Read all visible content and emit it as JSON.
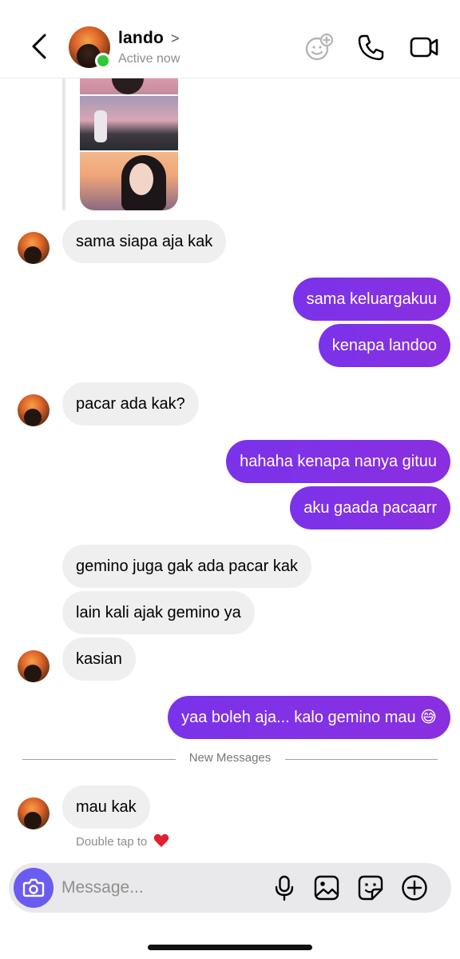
{
  "header": {
    "contact_name": "lando",
    "status": "Active now",
    "chevron": ">",
    "icons": [
      "back-arrow-icon",
      "effects-icon",
      "phone-icon",
      "video-icon"
    ]
  },
  "messages": [
    {
      "dir": "in",
      "text": "sama siapa aja kak"
    },
    {
      "dir": "out",
      "text": "sama keluargakuu"
    },
    {
      "dir": "out",
      "text": "kenapa landoo"
    },
    {
      "dir": "in",
      "text": "pacar ada kak?"
    },
    {
      "dir": "out",
      "text": "hahaha kenapa nanya gituu"
    },
    {
      "dir": "out",
      "text": "aku gaada pacaarr"
    },
    {
      "dir": "in",
      "text": "gemino juga gak ada pacar kak"
    },
    {
      "dir": "in",
      "text": "lain kali ajak gemino ya"
    },
    {
      "dir": "in",
      "text": "kasian"
    },
    {
      "dir": "out",
      "text": "yaa boleh aja... kalo gemino mau 😅"
    },
    {
      "dir": "in",
      "text": "mau kak"
    }
  ],
  "divider": {
    "label": "New Messages"
  },
  "hint": {
    "label": "Double tap to",
    "emoji": "heart"
  },
  "composer": {
    "placeholder": "Message...",
    "icons": [
      "camera-icon",
      "microphone-icon",
      "gallery-icon",
      "sticker-icon",
      "plus-circle-icon"
    ]
  },
  "colors": {
    "outgoing_bubble": "#7b2ee8",
    "incoming_bubble": "#efeff0",
    "online_dot": "#2dc937",
    "camera_button": "#6a5cf0"
  }
}
